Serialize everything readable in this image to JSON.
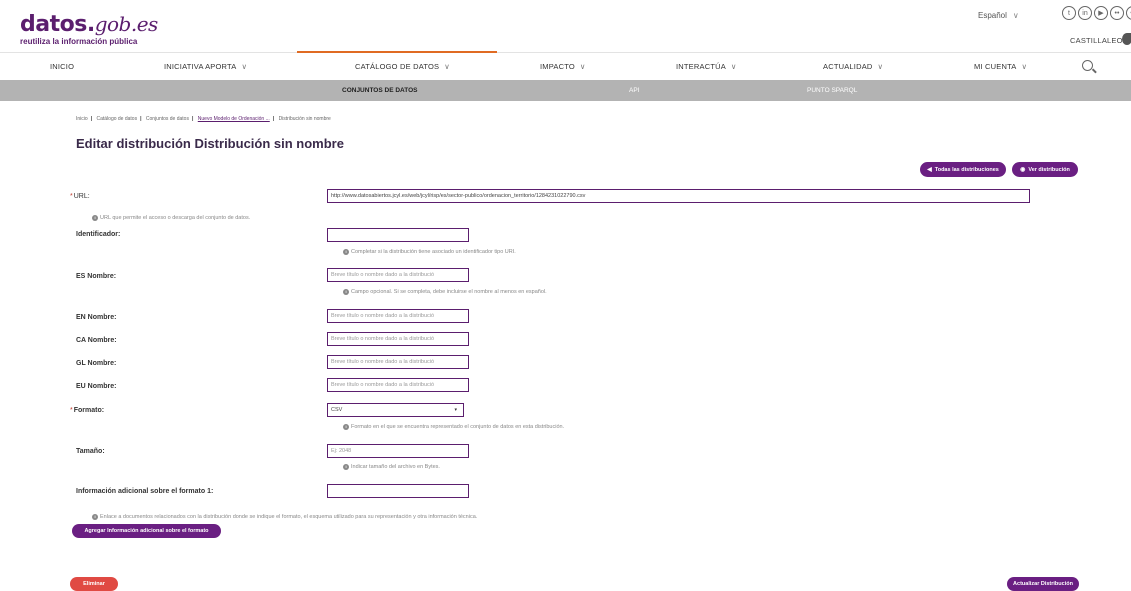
{
  "header": {
    "logo_main": "datos.",
    "logo_gob": "gob.es",
    "logo_sub": "reutiliza la información pública",
    "language": "Español",
    "brand_right": "CASTILLALEON"
  },
  "social_icons": [
    "twitter-icon",
    "linkedin-icon",
    "youtube-icon",
    "flickr-icon",
    "rss-icon"
  ],
  "main_nav": [
    {
      "label": "INICIO",
      "dropdown": false
    },
    {
      "label": "INICIATIVA APORTA",
      "dropdown": true
    },
    {
      "label": "CATÁLOGO DE DATOS",
      "dropdown": true,
      "active": true
    },
    {
      "label": "IMPACTO",
      "dropdown": true
    },
    {
      "label": "INTERACTÚA",
      "dropdown": true
    },
    {
      "label": "ACTUALIDAD",
      "dropdown": true
    },
    {
      "label": "MI CUENTA",
      "dropdown": true
    }
  ],
  "sub_nav": [
    {
      "label": "CONJUNTOS DE DATOS",
      "active": true
    },
    {
      "label": "API"
    },
    {
      "label": "PUNTO SPARQL"
    }
  ],
  "breadcrumb": [
    "Inicio",
    "Catálogo de datos",
    "Conjuntos de datos",
    "Nuevo Modelo de Ordenación ...",
    "Distribución sin nombre"
  ],
  "page_title": "Editar distribución Distribución sin nombre",
  "actions": {
    "all_distributions": "Todas las distribuciones",
    "view_distribution": "Ver distribución"
  },
  "form": {
    "url_label": "URL:",
    "url_value": "http://www.datosabiertos.jcyl.es/web/jcyl/risp/es/sector-publico/ordenacion_territorio/1284231022790.csv",
    "url_help": "URL que permite el acceso o descarga del conjunto de datos.",
    "identifier_label": "Identificador:",
    "identifier_value": "",
    "identifier_help": "Completar si la distribución tiene asociado un identificador tipo URI.",
    "es_name_label": "ES Nombre:",
    "es_name_help": "Campo opcional. Si se completa, debe incluirse el nombre al menos en español.",
    "name_placeholder": "Breve título o nombre dado a la distribució",
    "en_name_label": "EN Nombre:",
    "ca_name_label": "CA Nombre:",
    "gl_name_label": "GL Nombre:",
    "eu_name_label": "EU Nombre:",
    "format_label": "Formato:",
    "format_value": "CSV",
    "format_help": "Formato en el que se encuentra representado el conjunto de datos en esta distribución.",
    "size_label": "Tamaño:",
    "size_placeholder": "Ej: 2048",
    "size_help": "Indicar tamaño del archivo en Bytes.",
    "extra_label": "Información adicional sobre el formato 1:",
    "extra_value": "",
    "extra_help": "Enlace a documentos relacionados con la distribución donde se indique el formato, el esquema utilizado para su representación y otra información técnica.",
    "add_extra_button": "Agregar Información adicional sobre el formato"
  },
  "footer_buttons": {
    "delete": "Eliminar",
    "update": "Actualizar Distribución"
  },
  "colors": {
    "brand_purple": "#6a1f82",
    "accent_orange": "#e06b23",
    "danger_red": "#e04a43",
    "subnav_gray": "#b3b3b3"
  }
}
